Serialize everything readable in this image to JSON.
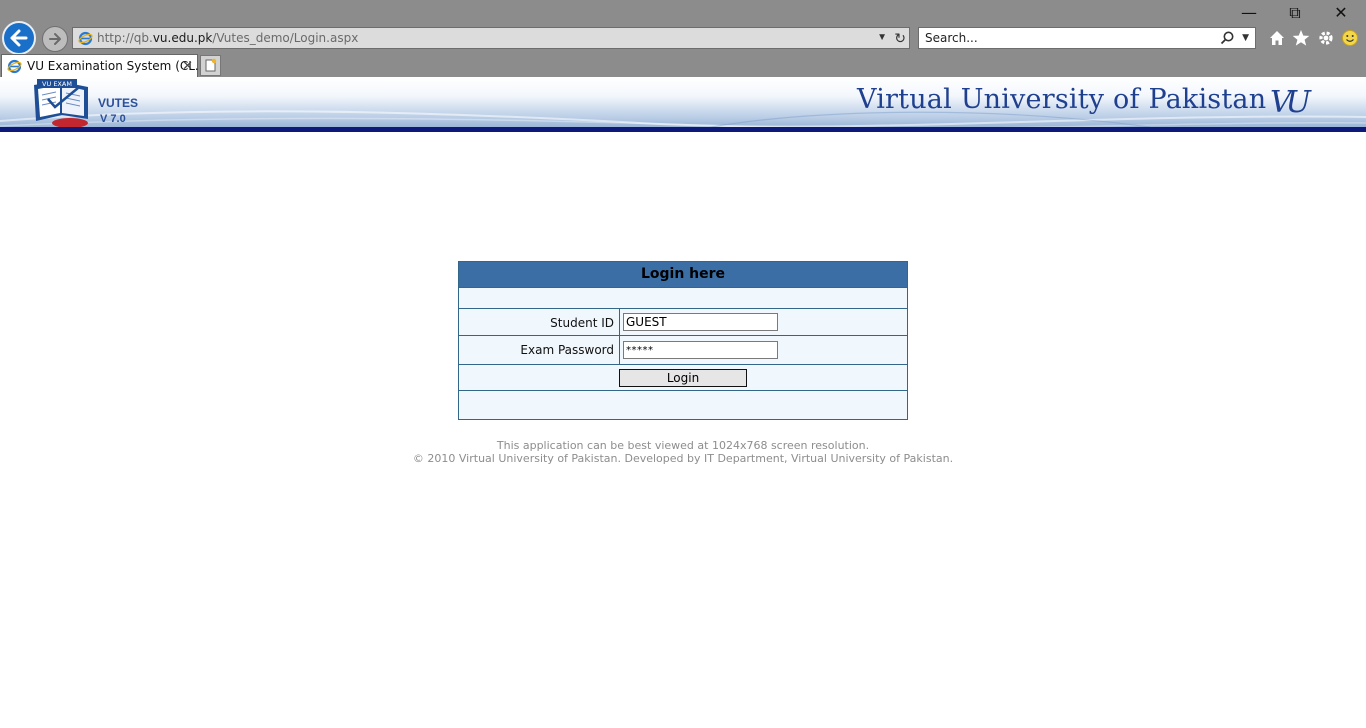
{
  "browser": {
    "window_controls": {
      "minimize": "—",
      "restore": "⧉",
      "close": "✕"
    },
    "address": {
      "url_prefix": "http://qb.",
      "url_domain": "vu.edu.pk",
      "url_path": "/Vutes_demo/Login.aspx"
    },
    "search": {
      "placeholder": "Search..."
    },
    "tab": {
      "title": "VU Examination System (CL...",
      "close": "✕"
    },
    "icons": [
      "back-icon",
      "forward-icon",
      "ie-icon",
      "refresh-icon",
      "search-icon",
      "home-icon",
      "favorites-icon",
      "settings-icon",
      "smiley-icon",
      "new-tab-icon"
    ]
  },
  "banner": {
    "logo_text": "VU EXAM",
    "app_name": "VUTES",
    "version": "V 7.0",
    "university": "Virtual University of Pakistan",
    "vu_logo": "VU"
  },
  "login": {
    "header": "Login here",
    "student_id_label": "Student ID",
    "student_id_value": "GUEST",
    "password_label": "Exam Password",
    "password_value": "*****",
    "button": "Login"
  },
  "footer": {
    "line1": "This application can be best viewed at 1024x768 screen resolution.",
    "line2": "© 2010 Virtual University of Pakistan. Developed by IT Department, Virtual University of Pakistan."
  },
  "colors": {
    "header_bg": "#3a6ea5",
    "box_bg": "#f0f7fd",
    "banner_bar": "#0d1a7a",
    "brand_text": "#1f3f8f"
  }
}
